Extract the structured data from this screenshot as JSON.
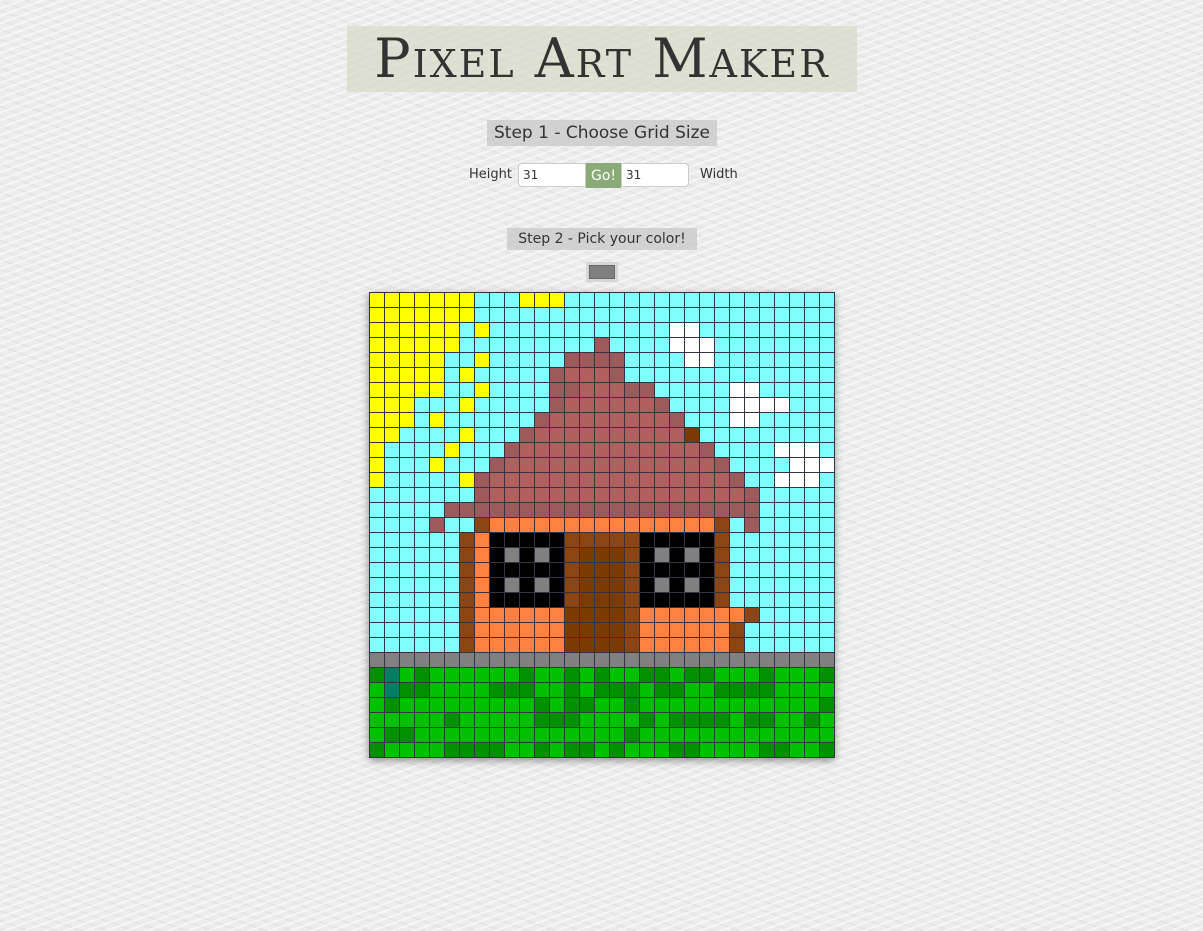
{
  "header": {
    "title": "Pixel Art Maker"
  },
  "step1": {
    "label": "Step 1 - Choose Grid Size",
    "height_label": "Height",
    "width_label": "Width",
    "height_value": "31",
    "width_value": "31",
    "submit_label": "Go!"
  },
  "step2": {
    "label": "Step 2 - Pick your color!",
    "selected_color": "#808080"
  },
  "canvas": {
    "rows": 31,
    "cols": 31,
    "palette": {
      "s": "#80ffff",
      "y": "#ffff00",
      "w": "#ffffff",
      "R": "#9c5a5a",
      "r": "#b0605c",
      "b": "#8b4513",
      "o": "#ff8040",
      "k": "#000000",
      "g": "#808080",
      "d": "#7a3a00",
      "G": "#00c000",
      "D": "#009000",
      "t": "#008060"
    },
    "pixels": [
      "yyyyyyysssyyyssssssssssssssssss",
      "yyyyyyyssssssssssssssssssssssss",
      "yyyyyysysssssssssssswwsssssssss",
      "yyyyyysssssssssRsssswwwsssssssss",
      "yyyyyssysssssRRRRsssswwsssssssss",
      "yyyyysysssssRrrrRssssssssssssss",
      "yyyyyssyssssRRrrrRRssssswwssssss",
      "yyysssysssssRrrrrrrRsssswwwwsss",
      "yyysyssssssRrrrrrrrrRssswwsssss",
      "yyssssysssRrrrrrrrrrrdssssssss",
      "yssssysssRrrrrrrrrrrrrRsssswwwssss",
      "ysssysssRrrrrrrrrrrrrrrRsssswwws",
      "ysssssyRrrrrrrrrrrrrrrrrRsswwws",
      "sssssssRrrrrrrrrrrrrrrrrrRsssss",
      "sssssRRRRRRRRRRRRRRRRRRRRRsssss",
      "ssssRssbooooooooooooooobsRssss",
      "ssssssbokkkkkbbbbbkkkkkbssssss",
      "ssssssbokgkgkbdddbkgkgkbssssss",
      "ssssssbokkkkkbdddbkkkkkbssssss",
      "ssssssbokgkgkbdddbkgkgkbssssss",
      "ssssssbokkkkkbdddbkkkkkbssssss",
      "ssssssbooooooddddbooooooobssssss",
      "ssssssbooooooddddboooooobssssss",
      "ssssssbooooooddddboooooobssssss",
      "ggggggggggggggggggggggggggggggg",
      "DtGDGGGGGGDGGDGDGGDDGDDGGGDGGGD",
      "GtDDGGGGDDDGGDGDDDGDDGGDDDDGGGG",
      "GDGGGGGGGGGDGDDGGDGGGGGGGGGGGGD",
      "GGGGGDGGGGGDDDGGGGDGDDDDGDDGGDG",
      "GDDGGGGGGGGGGGGGGDGGGGGGGGGGGGG",
      "DGGGGDDDDGGDGDDGDGGGDDGGGGDDGGD"
    ]
  }
}
